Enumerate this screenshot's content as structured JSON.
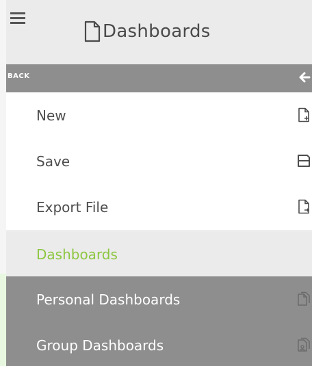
{
  "header": {
    "menu_icon": "hamburger-menu-icon",
    "title_icon": "document-icon",
    "title": "Dashboards"
  },
  "back": {
    "label": "BACK",
    "icon": "arrow-left-icon"
  },
  "menu": {
    "items": [
      {
        "label": "New",
        "icon": "new-file-icon"
      },
      {
        "label": "Save",
        "icon": "floppy-disk-icon"
      },
      {
        "label": "Export File",
        "icon": "export-file-icon"
      }
    ]
  },
  "section": {
    "label": "Dashboards"
  },
  "dashboards": {
    "items": [
      {
        "label": "Personal Dashboards",
        "icon": "copy-files-icon"
      },
      {
        "label": "Group Dashboards",
        "icon": "group-files-icon"
      }
    ]
  },
  "colors": {
    "header_bg": "#ebebeb",
    "bar_gray": "#8e8e8e",
    "accent_green": "#8cc63f",
    "text": "#4d4d4d"
  }
}
